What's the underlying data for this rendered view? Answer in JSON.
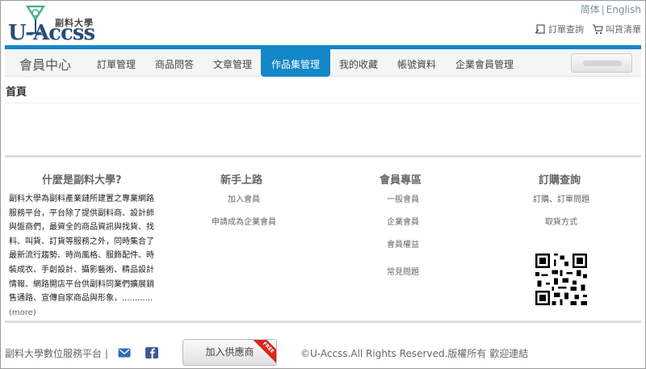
{
  "header": {
    "logo_sub": "副料大學",
    "logo_main": "U-Accss",
    "lang_tc": "简体",
    "lang_en": "English",
    "order_query": "訂單查詢",
    "cart": "叫貨清單"
  },
  "nav": {
    "title": "會員中心",
    "items": [
      {
        "label": "訂單管理"
      },
      {
        "label": "商品問答"
      },
      {
        "label": "文章管理"
      },
      {
        "label": "作品集管理"
      },
      {
        "label": "我的收藏"
      },
      {
        "label": "帳號資料"
      },
      {
        "label": "企業會員管理"
      }
    ],
    "active_index": 3
  },
  "breadcrumb": "首頁",
  "footer": {
    "about_title": "什麼是副料大學?",
    "about_text": "副料大學為副料產業鏈所建置之專業網路服務平台，平台除了提供副料商、設計師與盤商們，最資全的商品資訊與找貨、找料、叫貨、訂貨等服務之外，同時集合了最新流行趨勢、時尚風格、服飾配件、時裝成衣、手創設計、攝影藝術、精品設計情報、網路開店平台供副料同業們擴展銷售通路、宣傳自家商品與形象，............",
    "more": "(more)",
    "guide_title": "新手上路",
    "guide_links": [
      "加入會員",
      "申請成為企業會員"
    ],
    "member_title": "會員專區",
    "member_links": [
      "一般會員",
      "企業會員",
      "會員權益",
      "常見問題"
    ],
    "order_title": "訂購查詢",
    "order_links": [
      "訂購、訂單問題",
      "取貨方式"
    ]
  },
  "bottom": {
    "platform": "副料大學數位服務平台 |",
    "supplier_button": "加入供應商",
    "ribbon": "FREE",
    "copyright": "©U-Accss.All Rights Reserved.版權所有 歡迎連結"
  },
  "colors": {
    "accent": "#1387c8",
    "logo": "#2a4d7a",
    "ribbon": "#d9261c"
  }
}
